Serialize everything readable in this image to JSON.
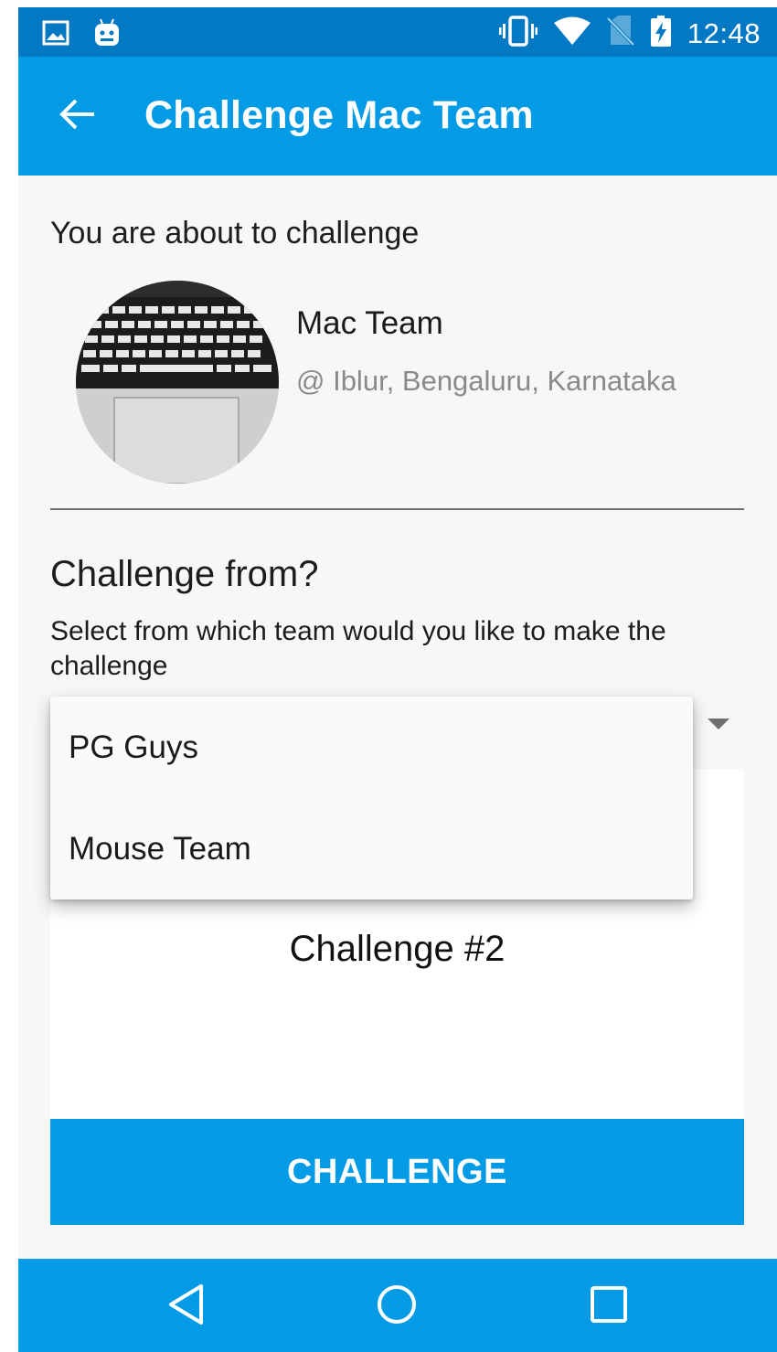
{
  "status_bar": {
    "time": "12:48",
    "left_icons": [
      "image-notification-icon",
      "android-notification-icon"
    ],
    "right_icons": [
      "vibrate-icon",
      "wifi-icon",
      "no-sim-icon",
      "battery-charging-icon"
    ]
  },
  "app_bar": {
    "title": "Challenge Mac Team",
    "back_icon": "arrow-back-icon"
  },
  "opponent": {
    "intro": "You are about to challenge",
    "name": "Mac Team",
    "location": "@ Iblur, Bengaluru, Karnataka"
  },
  "challenge_from": {
    "title": "Challenge from?",
    "description": "Select from which team would you like to make the challenge",
    "options": [
      {
        "label": "PG Guys"
      },
      {
        "label": "Mouse Team"
      }
    ]
  },
  "challenge_card": {
    "label": "Challenge #2"
  },
  "actions": {
    "challenge_label": "CHALLENGE"
  },
  "nav_bar": {
    "icons": [
      "back-triangle-icon",
      "home-circle-icon",
      "recents-square-icon"
    ]
  },
  "colors": {
    "status_bar": "#0279c2",
    "primary": "#039be5",
    "background": "#f7f7f7",
    "divider": "#6f6f6f"
  }
}
